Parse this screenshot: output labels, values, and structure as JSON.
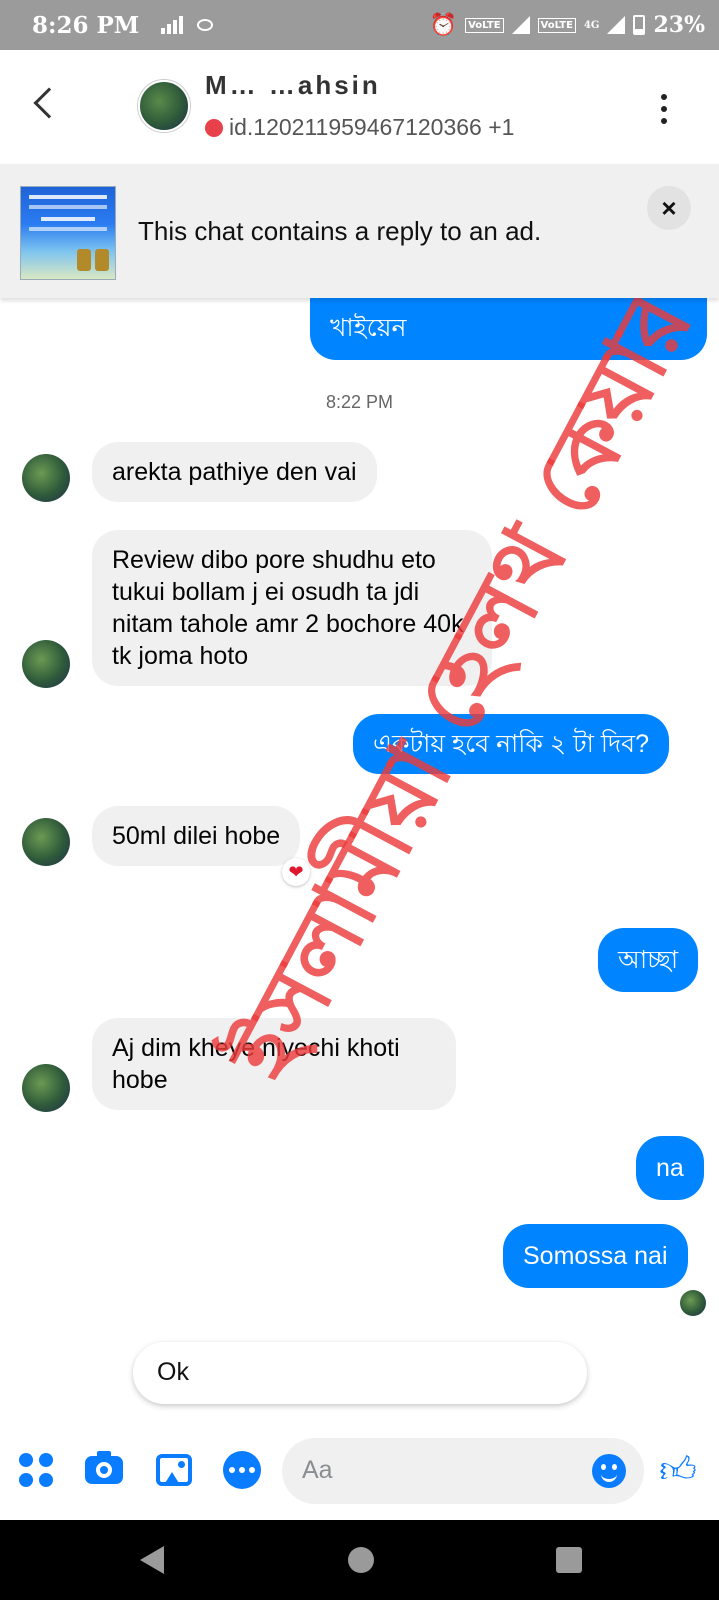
{
  "status_bar": {
    "time": "8:26 PM",
    "network_1": "VoLTE",
    "network_2": "VoLTE",
    "network_3": "4G",
    "battery": "23%"
  },
  "header": {
    "contact_name": "M… …ahsin",
    "contact_sub": "id.120211959467120366 +1"
  },
  "ad_banner": {
    "text": "This chat contains a reply to an ad.",
    "close_label": "×"
  },
  "timestamp": "8:22 PM",
  "messages": [
    {
      "direction": "out",
      "text": "খাইয়েন"
    },
    {
      "direction": "in",
      "text": "arekta pathiye den vai"
    },
    {
      "direction": "in",
      "text": "Review dibo pore shudhu eto tukui bollam j ei osudh ta jdi nitam tahole amr 2 bochore 40k tk joma hoto"
    },
    {
      "direction": "out",
      "text": "একটায় হবে নাকি ২ টা দিব?"
    },
    {
      "direction": "in",
      "text": "50ml dilei hobe",
      "reaction": "❤"
    },
    {
      "direction": "out",
      "text": "আচ্ছা"
    },
    {
      "direction": "in",
      "text": "Aj dim kheye niyechi khoti hobe"
    },
    {
      "direction": "out",
      "text": "na"
    },
    {
      "direction": "out",
      "text": "Somossa nai"
    }
  ],
  "quick_reply": "Ok",
  "composer": {
    "placeholder": "Aa"
  },
  "watermark": "ইসলামীয়া হেলথ কেয়ার",
  "colors": {
    "accent": "#0084ff",
    "incoming_bubble": "#f0f0f0",
    "watermark": "#eb3c3c"
  }
}
